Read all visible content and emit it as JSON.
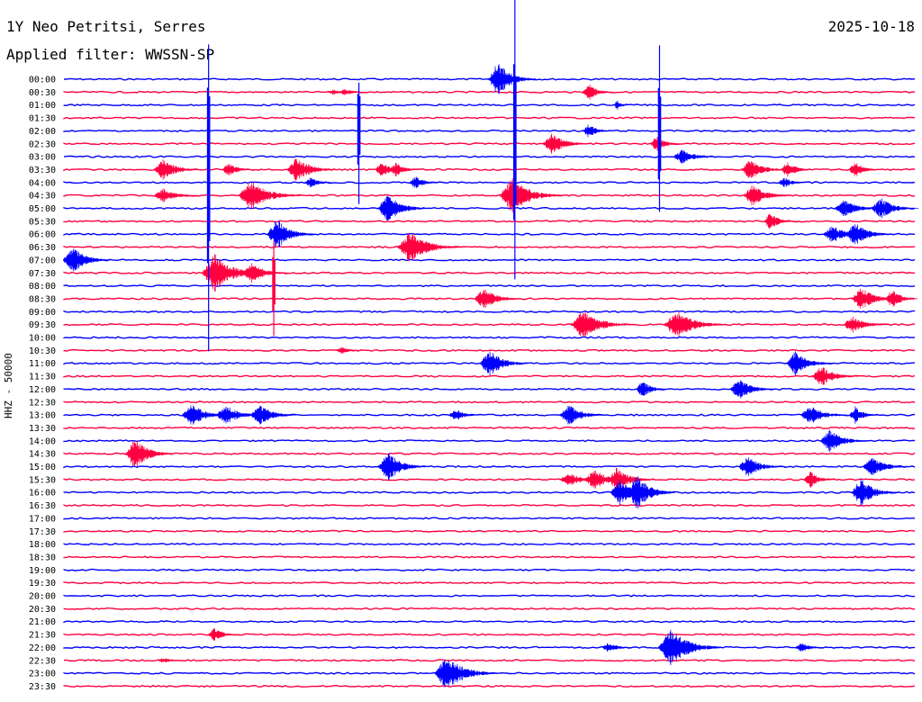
{
  "header": {
    "station": "1Y Neo Petritsi, Serres",
    "date": "2025-10-18",
    "filter": "Applied filter: WWSSN-SP"
  },
  "chart_data": {
    "type": "line",
    "ylabel": "HHZ - 50000",
    "colors": {
      "even_trace": "#0000ff",
      "odd_trace": "#ff0040"
    },
    "traces": [
      {
        "label": "00:00",
        "color": "blue"
      },
      {
        "label": "00:30",
        "color": "red"
      },
      {
        "label": "01:00",
        "color": "blue"
      },
      {
        "label": "01:30",
        "color": "red"
      },
      {
        "label": "02:00",
        "color": "blue"
      },
      {
        "label": "02:30",
        "color": "red"
      },
      {
        "label": "03:00",
        "color": "blue"
      },
      {
        "label": "03:30",
        "color": "red"
      },
      {
        "label": "04:00",
        "color": "blue"
      },
      {
        "label": "04:30",
        "color": "red"
      },
      {
        "label": "05:00",
        "color": "blue"
      },
      {
        "label": "05:30",
        "color": "red"
      },
      {
        "label": "06:00",
        "color": "blue"
      },
      {
        "label": "06:30",
        "color": "red"
      },
      {
        "label": "07:00",
        "color": "blue"
      },
      {
        "label": "07:30",
        "color": "red"
      },
      {
        "label": "08:00",
        "color": "blue"
      },
      {
        "label": "08:30",
        "color": "red"
      },
      {
        "label": "09:00",
        "color": "blue"
      },
      {
        "label": "09:30",
        "color": "red"
      },
      {
        "label": "10:00",
        "color": "blue"
      },
      {
        "label": "10:30",
        "color": "red"
      },
      {
        "label": "11:00",
        "color": "blue"
      },
      {
        "label": "11:30",
        "color": "red"
      },
      {
        "label": "12:00",
        "color": "blue"
      },
      {
        "label": "12:30",
        "color": "red"
      },
      {
        "label": "13:00",
        "color": "blue"
      },
      {
        "label": "13:30",
        "color": "red"
      },
      {
        "label": "14:00",
        "color": "blue"
      },
      {
        "label": "14:30",
        "color": "red"
      },
      {
        "label": "15:00",
        "color": "blue"
      },
      {
        "label": "15:30",
        "color": "red"
      },
      {
        "label": "16:00",
        "color": "blue"
      },
      {
        "label": "16:30",
        "color": "red"
      },
      {
        "label": "17:00",
        "color": "blue"
      },
      {
        "label": "17:30",
        "color": "red"
      },
      {
        "label": "18:00",
        "color": "blue"
      },
      {
        "label": "18:30",
        "color": "red"
      },
      {
        "label": "19:00",
        "color": "blue"
      },
      {
        "label": "19:30",
        "color": "red"
      },
      {
        "label": "20:00",
        "color": "blue"
      },
      {
        "label": "20:30",
        "color": "red"
      },
      {
        "label": "21:00",
        "color": "blue"
      },
      {
        "label": "21:30",
        "color": "red"
      },
      {
        "label": "22:00",
        "color": "blue"
      },
      {
        "label": "22:30",
        "color": "red"
      },
      {
        "label": "23:00",
        "color": "blue"
      },
      {
        "label": "23:30",
        "color": "red"
      }
    ],
    "events": [
      {
        "trace": 0,
        "minute": 15.3,
        "amp": 20,
        "len": 3
      },
      {
        "trace": 1,
        "minute": 9.5,
        "amp": 3,
        "len": 2
      },
      {
        "trace": 1,
        "minute": 9.9,
        "amp": 4,
        "len": 2
      },
      {
        "trace": 1,
        "minute": 18.5,
        "amp": 10,
        "len": 2
      },
      {
        "trace": 2,
        "minute": 19.5,
        "amp": 6,
        "len": 1
      },
      {
        "trace": 4,
        "minute": 18.5,
        "amp": 8,
        "len": 2
      },
      {
        "trace": 5,
        "minute": 17.2,
        "amp": 12,
        "len": 3
      },
      {
        "trace": 5,
        "minute": 20.9,
        "amp": 9,
        "len": 2
      },
      {
        "trace": 6,
        "minute": 21.8,
        "amp": 8,
        "len": 3
      },
      {
        "trace": 7,
        "minute": 3.5,
        "amp": 12,
        "len": 3
      },
      {
        "trace": 7,
        "minute": 5.8,
        "amp": 8,
        "len": 2
      },
      {
        "trace": 7,
        "minute": 8.2,
        "amp": 15,
        "len": 3
      },
      {
        "trace": 7,
        "minute": 11.2,
        "amp": 10,
        "len": 2
      },
      {
        "trace": 7,
        "minute": 11.7,
        "amp": 8,
        "len": 2
      },
      {
        "trace": 7,
        "minute": 24.2,
        "amp": 12,
        "len": 3
      },
      {
        "trace": 7,
        "minute": 25.5,
        "amp": 10,
        "len": 2
      },
      {
        "trace": 7,
        "minute": 27.9,
        "amp": 10,
        "len": 2
      },
      {
        "trace": 8,
        "minute": 8.7,
        "amp": 6,
        "len": 2
      },
      {
        "trace": 8,
        "minute": 12.4,
        "amp": 8,
        "len": 2
      },
      {
        "trace": 8,
        "minute": 25.4,
        "amp": 6,
        "len": 2
      },
      {
        "trace": 9,
        "minute": 3.5,
        "amp": 8,
        "len": 3
      },
      {
        "trace": 9,
        "minute": 6.6,
        "amp": 18,
        "len": 4
      },
      {
        "trace": 9,
        "minute": 15.8,
        "amp": 20,
        "len": 4
      },
      {
        "trace": 9,
        "minute": 24.3,
        "amp": 14,
        "len": 3
      },
      {
        "trace": 10,
        "minute": 11.4,
        "amp": 18,
        "len": 3
      },
      {
        "trace": 10,
        "minute": 27.5,
        "amp": 10,
        "len": 3
      },
      {
        "trace": 10,
        "minute": 28.8,
        "amp": 12,
        "len": 3
      },
      {
        "trace": 11,
        "minute": 24.9,
        "amp": 10,
        "len": 2
      },
      {
        "trace": 12,
        "minute": 7.5,
        "amp": 18,
        "len": 3
      },
      {
        "trace": 12,
        "minute": 27.1,
        "amp": 10,
        "len": 3
      },
      {
        "trace": 12,
        "minute": 27.9,
        "amp": 14,
        "len": 3
      },
      {
        "trace": 13,
        "minute": 12.2,
        "amp": 18,
        "len": 4
      },
      {
        "trace": 14,
        "minute": 0.3,
        "amp": 16,
        "len": 3
      },
      {
        "trace": 15,
        "minute": 5.3,
        "amp": 22,
        "len": 4
      },
      {
        "trace": 15,
        "minute": 6.6,
        "amp": 12,
        "len": 3
      },
      {
        "trace": 17,
        "minute": 14.8,
        "amp": 12,
        "len": 3
      },
      {
        "trace": 17,
        "minute": 28.1,
        "amp": 14,
        "len": 3
      },
      {
        "trace": 17,
        "minute": 29.2,
        "amp": 12,
        "len": 2
      },
      {
        "trace": 19,
        "minute": 18.3,
        "amp": 16,
        "len": 4
      },
      {
        "trace": 19,
        "minute": 21.6,
        "amp": 16,
        "len": 4
      },
      {
        "trace": 19,
        "minute": 27.8,
        "amp": 10,
        "len": 3
      },
      {
        "trace": 21,
        "minute": 9.8,
        "amp": 4,
        "len": 2
      },
      {
        "trace": 22,
        "minute": 15.0,
        "amp": 16,
        "len": 3
      },
      {
        "trace": 22,
        "minute": 25.8,
        "amp": 14,
        "len": 3
      },
      {
        "trace": 23,
        "minute": 26.7,
        "amp": 12,
        "len": 3
      },
      {
        "trace": 24,
        "minute": 20.4,
        "amp": 10,
        "len": 2
      },
      {
        "trace": 24,
        "minute": 23.8,
        "amp": 12,
        "len": 3
      },
      {
        "trace": 26,
        "minute": 4.5,
        "amp": 14,
        "len": 3
      },
      {
        "trace": 26,
        "minute": 5.7,
        "amp": 12,
        "len": 3
      },
      {
        "trace": 26,
        "minute": 6.9,
        "amp": 12,
        "len": 3
      },
      {
        "trace": 26,
        "minute": 13.8,
        "amp": 8,
        "len": 2
      },
      {
        "trace": 26,
        "minute": 17.8,
        "amp": 12,
        "len": 3
      },
      {
        "trace": 26,
        "minute": 26.3,
        "amp": 12,
        "len": 3
      },
      {
        "trace": 26,
        "minute": 27.9,
        "amp": 10,
        "len": 2
      },
      {
        "trace": 28,
        "minute": 27.0,
        "amp": 14,
        "len": 3
      },
      {
        "trace": 29,
        "minute": 2.5,
        "amp": 18,
        "len": 3
      },
      {
        "trace": 30,
        "minute": 11.4,
        "amp": 18,
        "len": 3
      },
      {
        "trace": 30,
        "minute": 24.1,
        "amp": 12,
        "len": 3
      },
      {
        "trace": 30,
        "minute": 28.5,
        "amp": 12,
        "len": 3
      },
      {
        "trace": 31,
        "minute": 17.8,
        "amp": 8,
        "len": 3
      },
      {
        "trace": 31,
        "minute": 18.7,
        "amp": 12,
        "len": 3
      },
      {
        "trace": 31,
        "minute": 19.5,
        "amp": 14,
        "len": 3
      },
      {
        "trace": 31,
        "minute": 26.3,
        "amp": 10,
        "len": 2
      },
      {
        "trace": 32,
        "minute": 19.6,
        "amp": 14,
        "len": 3
      },
      {
        "trace": 32,
        "minute": 20.2,
        "amp": 20,
        "len": 3
      },
      {
        "trace": 32,
        "minute": 28.1,
        "amp": 16,
        "len": 3
      },
      {
        "trace": 43,
        "minute": 5.3,
        "amp": 8,
        "len": 2
      },
      {
        "trace": 44,
        "minute": 19.2,
        "amp": 6,
        "len": 2
      },
      {
        "trace": 44,
        "minute": 21.4,
        "amp": 22,
        "len": 4
      },
      {
        "trace": 44,
        "minute": 26.0,
        "amp": 6,
        "len": 2
      },
      {
        "trace": 45,
        "minute": 3.5,
        "amp": 3,
        "len": 2
      },
      {
        "trace": 46,
        "minute": 13.5,
        "amp": 20,
        "len": 4
      }
    ],
    "spikes": [
      {
        "trace": 4,
        "minute": 5.1,
        "up": 96,
        "down": 245
      },
      {
        "trace": 4,
        "minute": 15.9,
        "up": 148,
        "down": 165
      },
      {
        "trace": 4,
        "minute": 21.0,
        "up": 95,
        "down": 90
      },
      {
        "trace": 2,
        "minute": 10.4,
        "up": 25,
        "down": 110
      },
      {
        "trace": 15,
        "minute": 7.4,
        "up": 35,
        "down": 70
      }
    ]
  }
}
